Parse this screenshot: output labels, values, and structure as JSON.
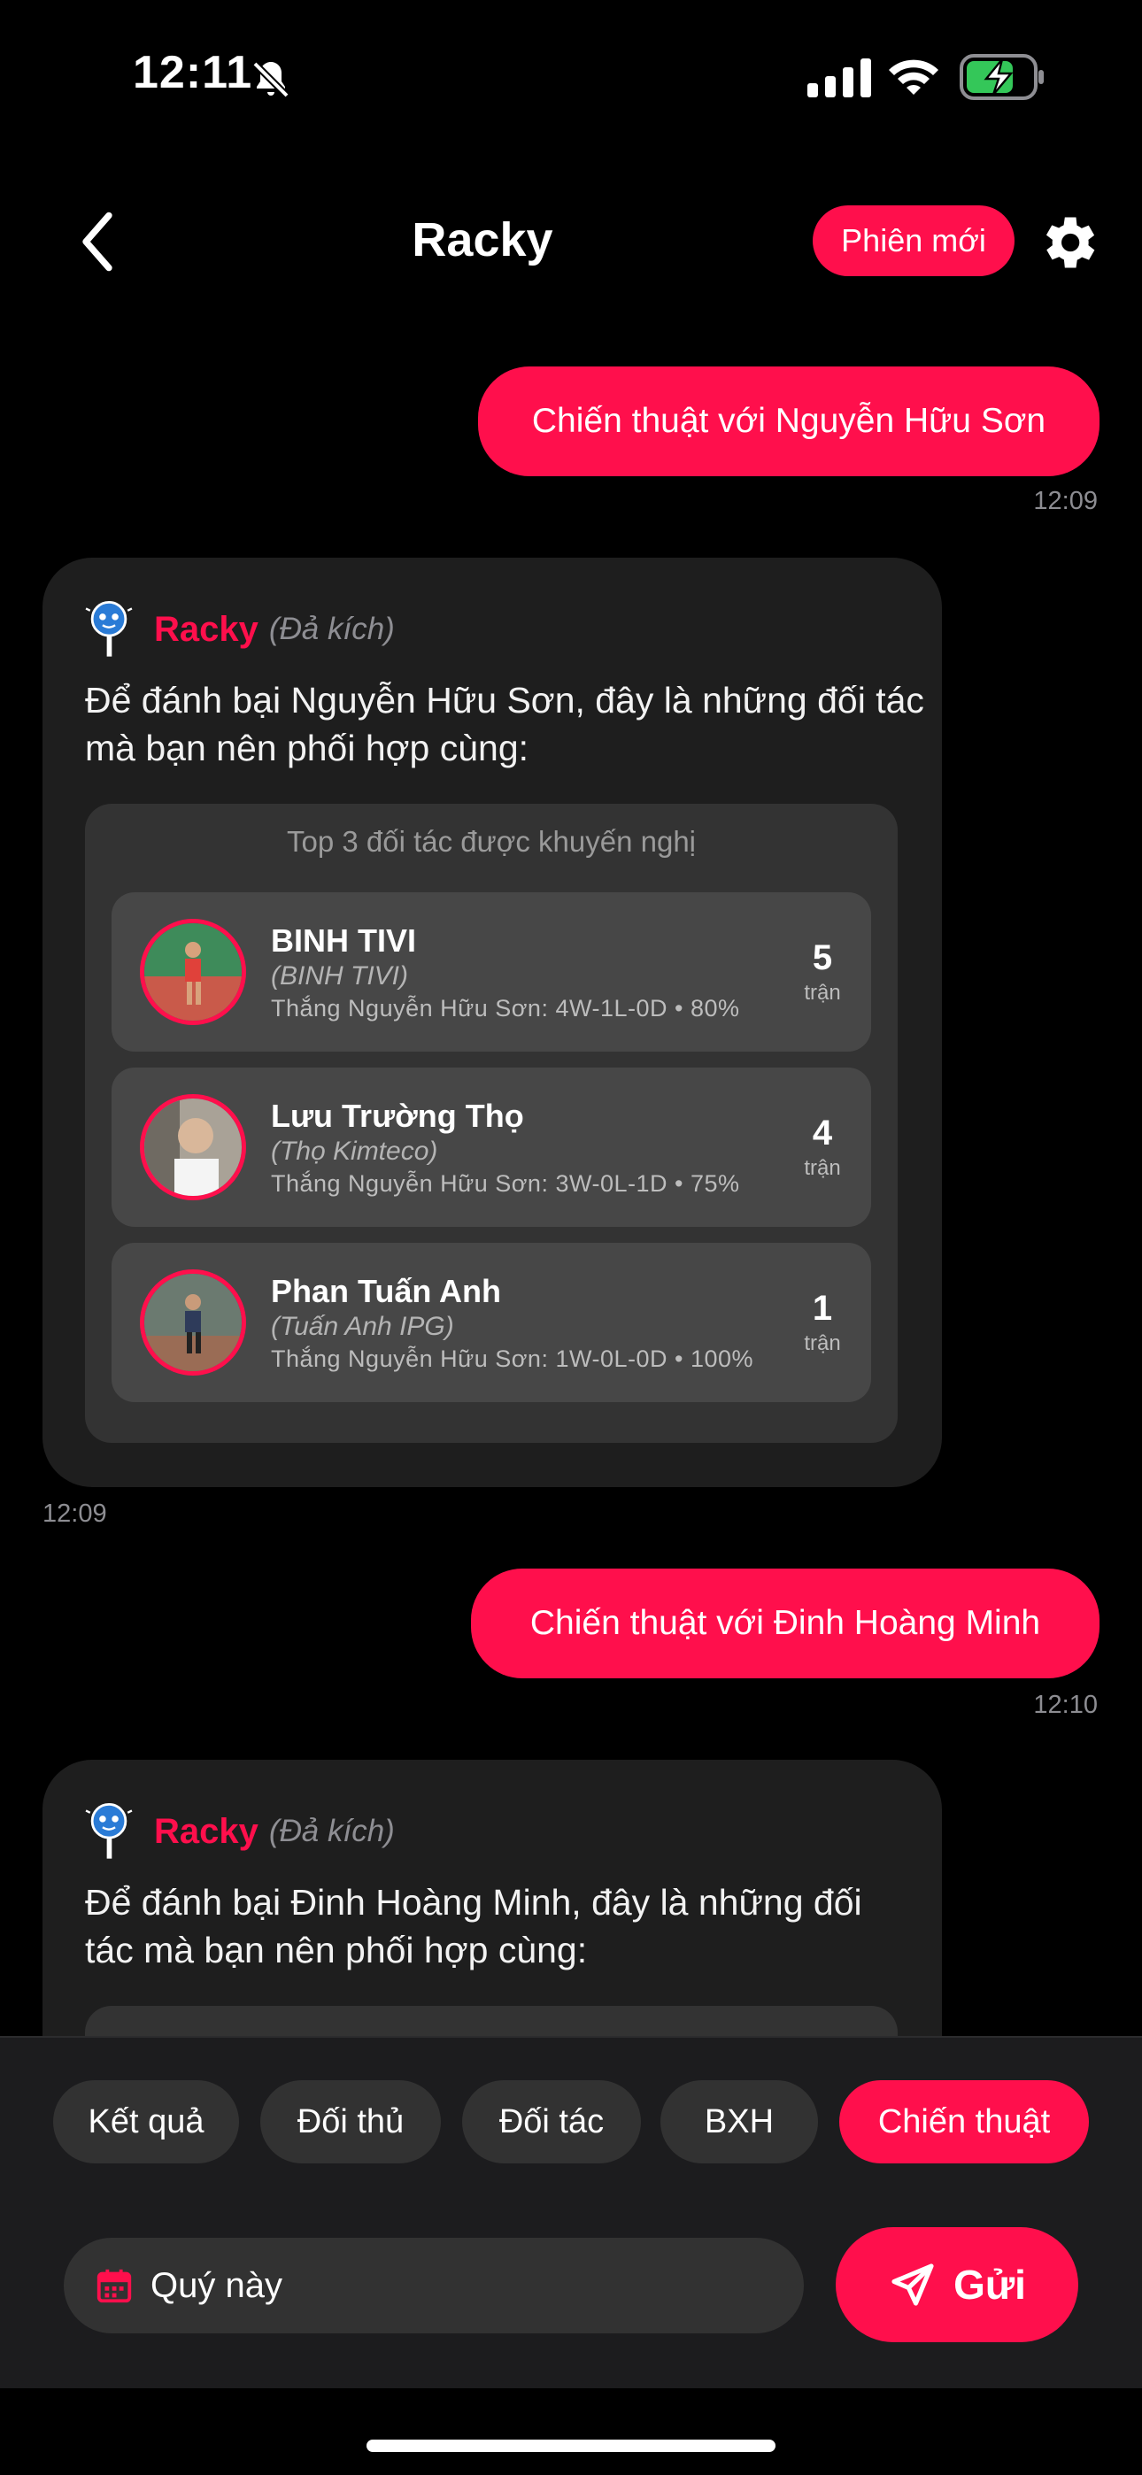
{
  "status_bar": {
    "time": "12:11"
  },
  "header": {
    "title": "Racky",
    "new_session_label": "Phiên mới"
  },
  "messages": [
    {
      "type": "user",
      "text": "Chiến thuật với Nguyễn Hữu Sơn",
      "time": "12:09"
    },
    {
      "type": "bot",
      "sender": "Racky",
      "sender_sub": "(Đả kích)",
      "text": "Để đánh bại Nguyễn Hữu Sơn, đây là những đối tác mà bạn nên phối hợp cùng:",
      "reco_title": "Top 3 đối tác được khuyến nghị",
      "partners": [
        {
          "name": "BINH TIVI",
          "nick": "(BINH TIVI)",
          "stat": "Thắng Nguyễn Hữu Sơn: 4W-1L-0D • 80%",
          "count": "5",
          "unit": "trận"
        },
        {
          "name": "Lưu Trường Thọ",
          "nick": "(Thọ Kimteco)",
          "stat": "Thắng Nguyễn Hữu Sơn: 3W-0L-1D • 75%",
          "count": "4",
          "unit": "trận"
        },
        {
          "name": "Phan Tuấn Anh",
          "nick": "(Tuấn Anh IPG)",
          "stat": "Thắng Nguyễn Hữu Sơn: 1W-0L-0D • 100%",
          "count": "1",
          "unit": "trận"
        }
      ],
      "time": "12:09"
    },
    {
      "type": "user",
      "text": "Chiến thuật với Đinh Hoàng Minh",
      "time": "12:10"
    },
    {
      "type": "bot",
      "sender": "Racky",
      "sender_sub": "(Đả kích)",
      "text": "Để đánh bại Đinh Hoàng Minh, đây là những đối tác mà bạn nên phối hợp cùng:"
    }
  ],
  "quick_chips": [
    {
      "label": "Kết quả",
      "active": false
    },
    {
      "label": "Đối thủ",
      "active": false
    },
    {
      "label": "Đối tác",
      "active": false
    },
    {
      "label": "BXH",
      "active": false
    },
    {
      "label": "Chiến thuật",
      "active": true
    }
  ],
  "input": {
    "value": "Quý này"
  },
  "send_button": {
    "label": "Gửi"
  },
  "colors": {
    "accent": "#FF0F4C",
    "background": "#000000",
    "card": "#1e1e1e"
  }
}
